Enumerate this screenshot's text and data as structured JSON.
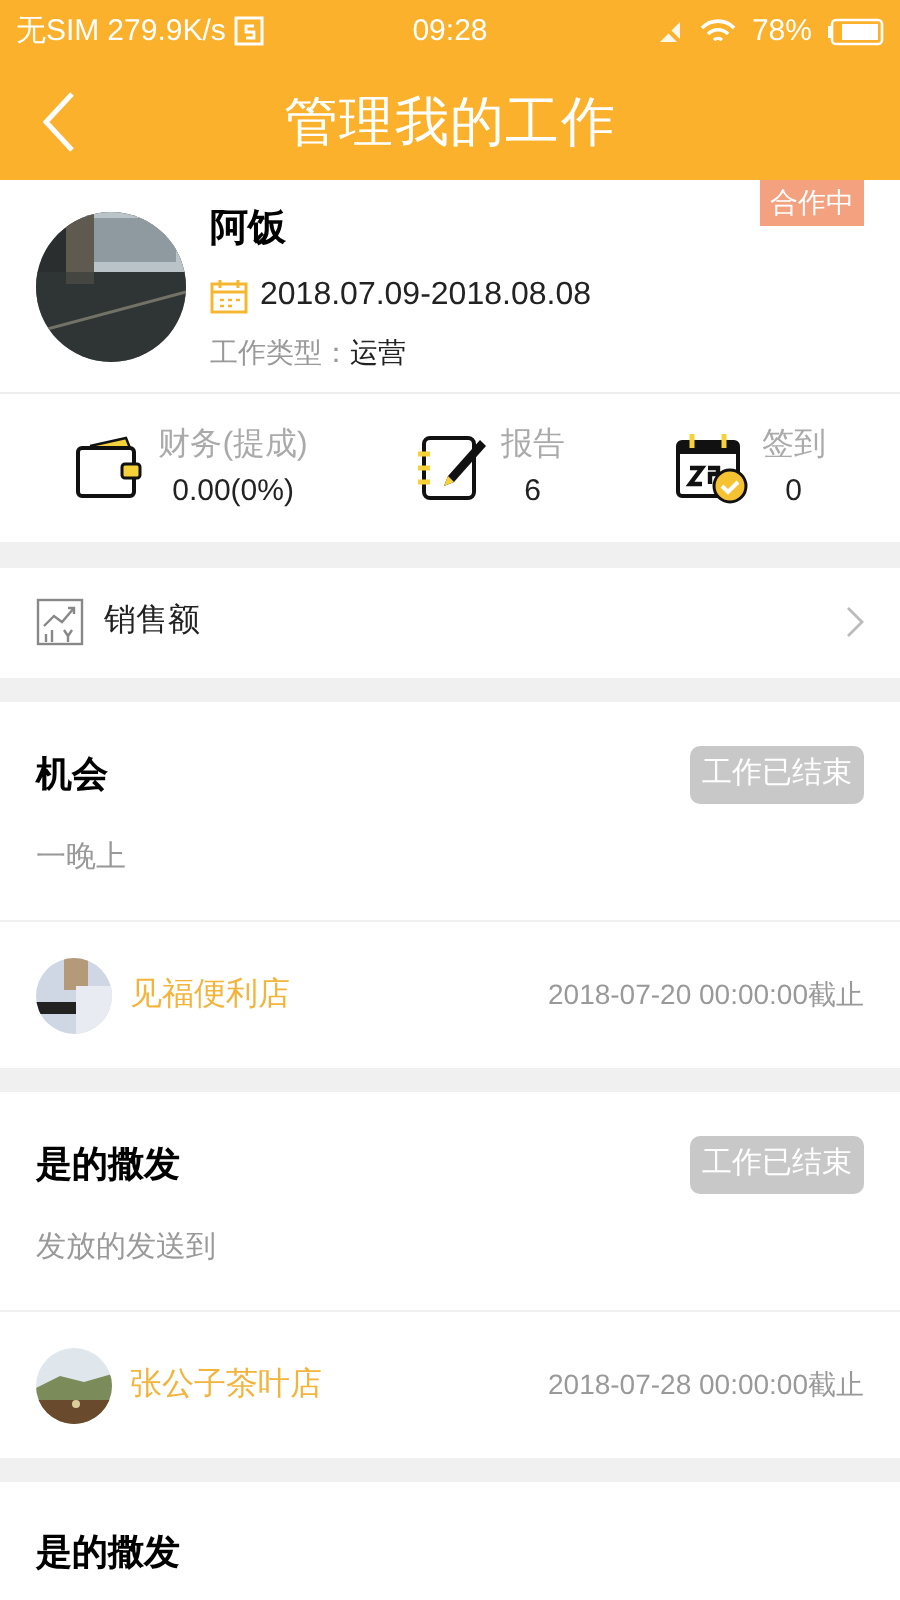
{
  "status_bar": {
    "carrier": "无SIM",
    "speed": "279.9K/s",
    "time": "09:28",
    "battery": "78%"
  },
  "header": {
    "title": "管理我的工作"
  },
  "profile": {
    "name": "阿饭",
    "date_range": "2018.07.09-2018.08.08",
    "type_label": "工作类型：",
    "type_value": "运营",
    "badge": "合作中"
  },
  "stats": [
    {
      "kind": "wallet",
      "label": "财务(提成)",
      "value": "0.00(0%)"
    },
    {
      "kind": "report",
      "label": "报告",
      "value": "6"
    },
    {
      "kind": "checkin",
      "label": "签到",
      "value": "0"
    }
  ],
  "menu": {
    "label": "销售额"
  },
  "tasks": [
    {
      "title": "机会",
      "status": "工作已结束",
      "description": "一晚上",
      "store": "见福便利店",
      "deadline": "2018-07-20 00:00:00截止"
    },
    {
      "title": "是的撒发",
      "status": "工作已结束",
      "description": "发放的发送到",
      "store": "张公子茶叶店",
      "deadline": "2018-07-28 00:00:00截止"
    },
    {
      "title": "是的撒发"
    }
  ]
}
